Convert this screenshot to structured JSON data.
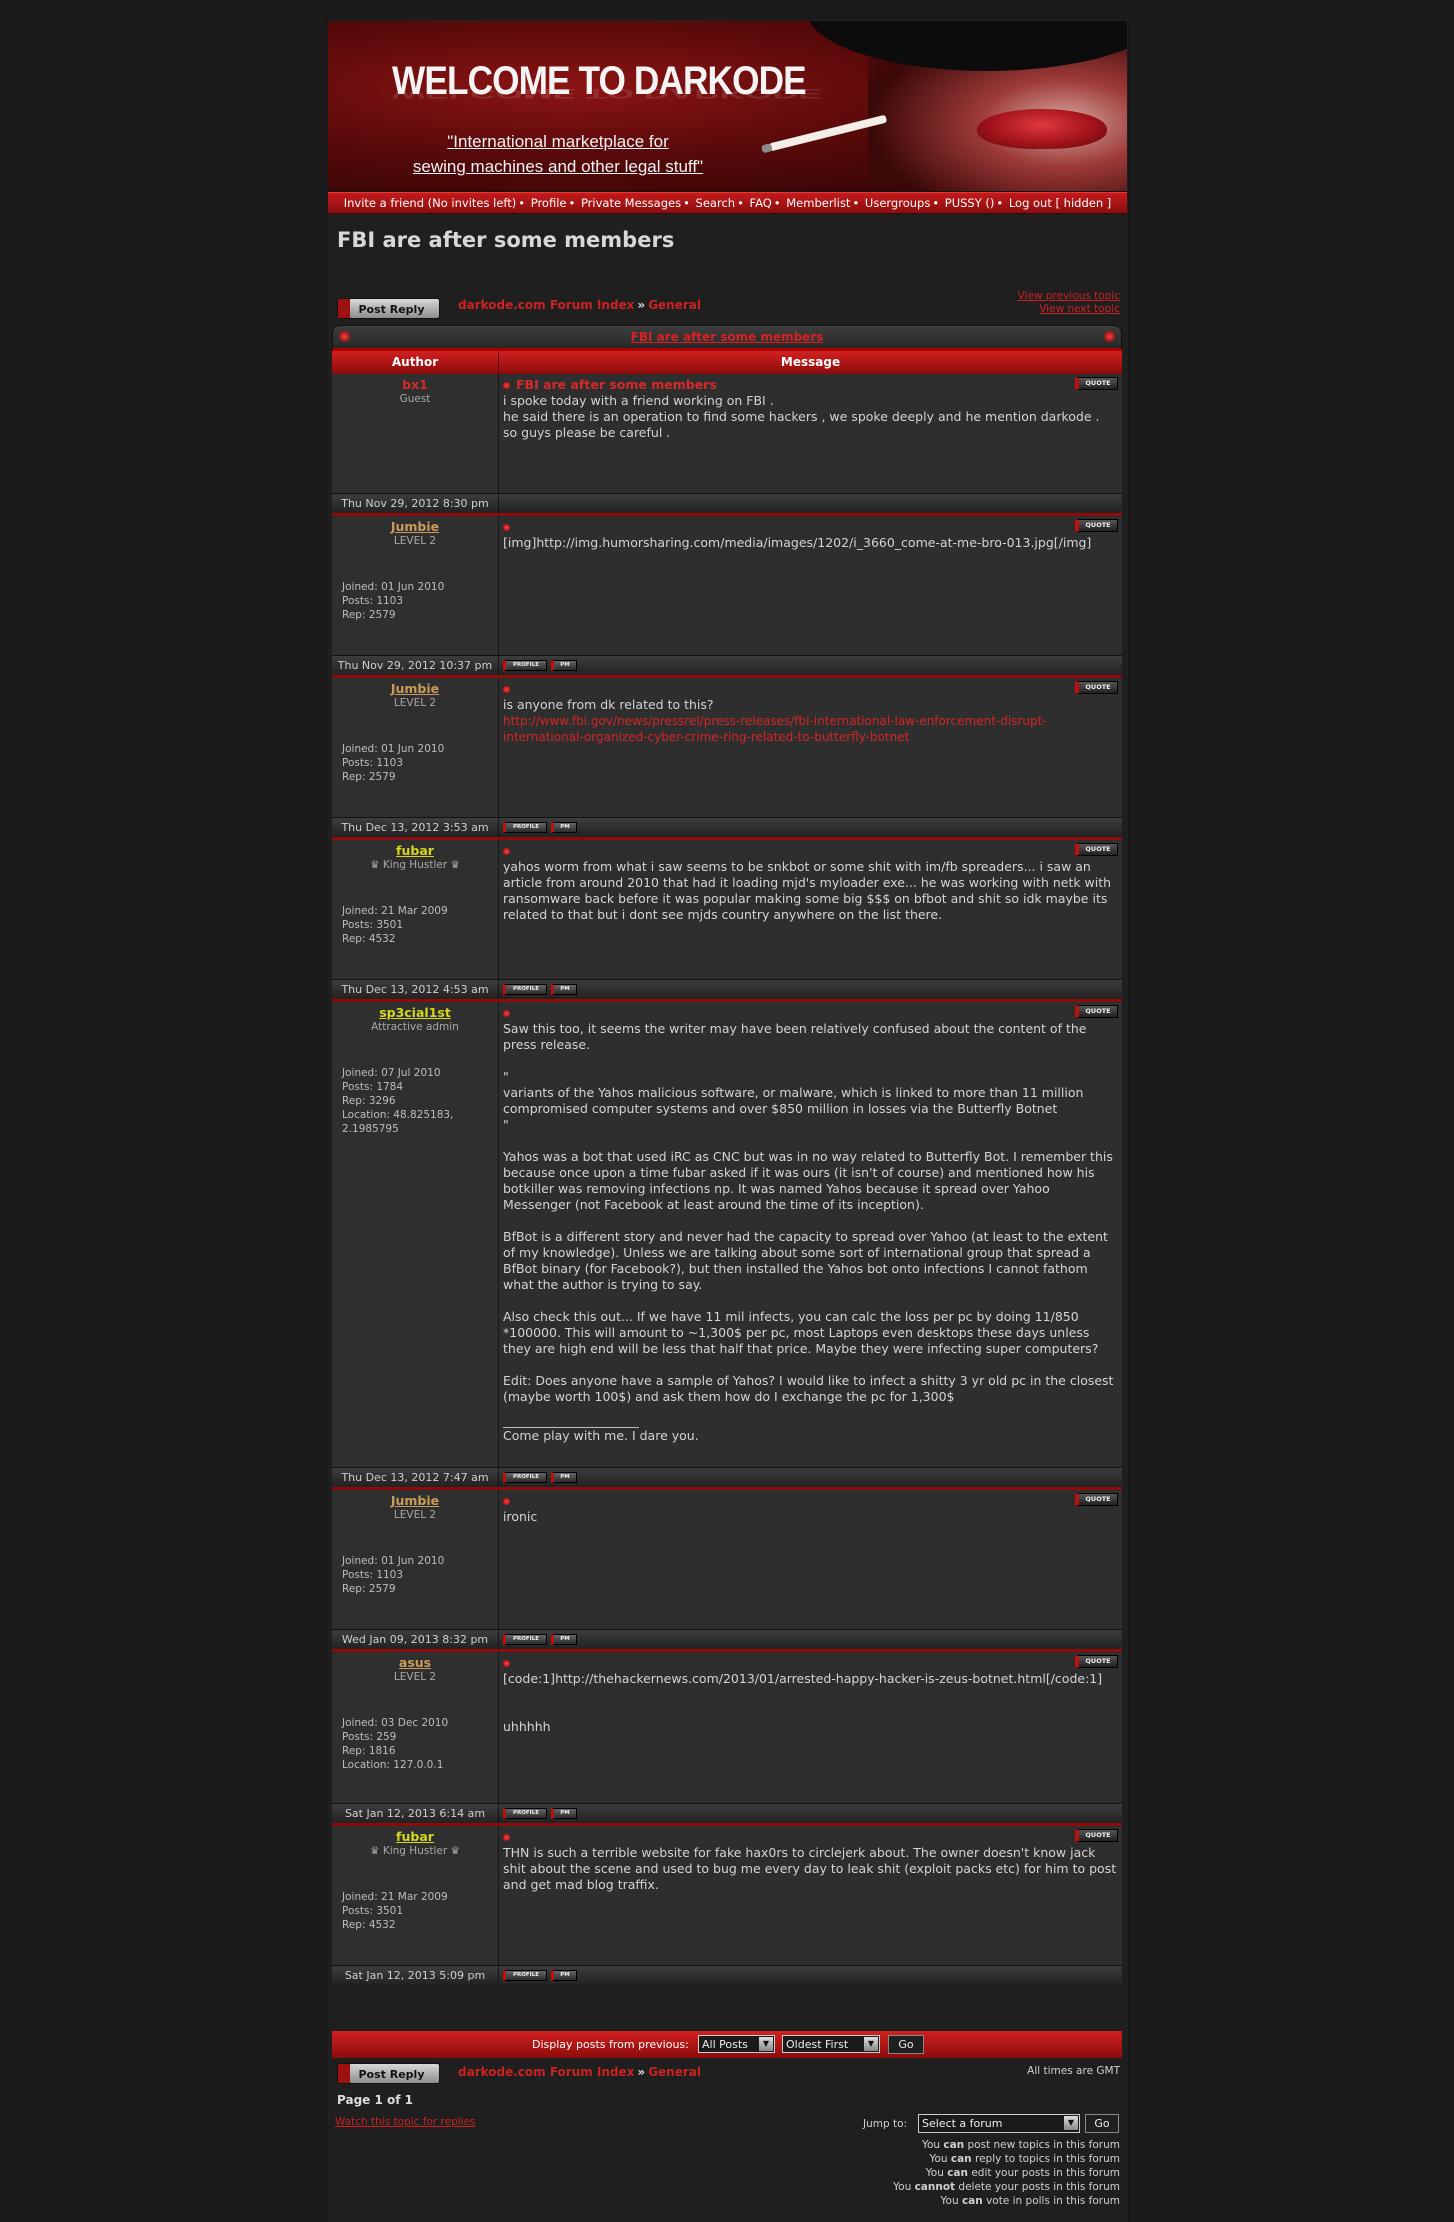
{
  "banner": {
    "title": "WELCOME TO DARKODE",
    "tagline_line1": "\"International marketplace for",
    "tagline_line2": "sewing machines and other legal stuff\""
  },
  "nav": {
    "items": [
      "Invite a friend (No invites left)",
      "Profile",
      "Private Messages",
      "Search",
      "FAQ",
      "Memberlist",
      "Usergroups",
      "PUSSY ()",
      "Log out [ hidden ]"
    ]
  },
  "page_title": "FBI are after some members",
  "post_reply_label": "Post Reply",
  "breadcrumb": {
    "index": "darkode.com Forum Index",
    "sep": "»",
    "forum": "General"
  },
  "view_previous": "View previous topic",
  "view_next": "View next topic",
  "topic_header": "FBI are after some members",
  "columns": {
    "author": "Author",
    "message": "Message"
  },
  "quote_label": "QUOTE",
  "profile_label": "PROFILE",
  "pm_label": "PM",
  "posts": [
    {
      "author": "bx1",
      "author_color": "#d62a2a",
      "rank": "Guest",
      "subject": "FBI are after some members",
      "lines": [
        "i spoke today with a friend working on FBI .",
        "he said there is an operation to find some hackers , we spoke deeply and he mention darkode .",
        "so guys please be careful ."
      ],
      "date": "Thu Nov 29, 2012 8:30 pm"
    },
    {
      "author": "Jumbie",
      "author_color": "#c99b5a",
      "rank": "LEVEL 2",
      "joined": "Joined: 01 Jun 2010",
      "posts": "Posts: 1103",
      "rep": "Rep: 2579",
      "lines": [
        "[img]http://img.humorsharing.com/media/images/1202/i_3660_come-at-me-bro-013.jpg[/img]"
      ],
      "date": "Thu Nov 29, 2012 10:37 pm"
    },
    {
      "author": "Jumbie",
      "author_color": "#c99b5a",
      "rank": "LEVEL 2",
      "joined": "Joined: 01 Jun 2010",
      "posts": "Posts: 1103",
      "rep": "Rep: 2579",
      "lines": [
        "is anyone from dk related to this?"
      ],
      "link": "http://www.fbi.gov/news/pressrel/press-releases/fbi-international-law-enforcement-disrupt-international-organized-cyber-crime-ring-related-to-butterfly-botnet",
      "date": "Thu Dec 13, 2012 3:53 am"
    },
    {
      "author": "fubar",
      "author_color": "#d6d61c",
      "rank": "♛ King Hustler ♛",
      "joined": "Joined: 21 Mar 2009",
      "posts": "Posts: 3501",
      "rep": "Rep: 4532",
      "lines": [
        "yahos worm from what i saw seems to be snkbot or some shit with im/fb spreaders... i saw an article from around 2010 that had it loading mjd's myloader exe... he was working with netk with ransomware back before it was popular making some big $$$ on bfbot and shit so idk maybe its related to that but i dont see mjds country anywhere on the list there."
      ],
      "date": "Thu Dec 13, 2012 4:53 am"
    },
    {
      "author": "sp3cial1st",
      "author_color": "#d6d61c",
      "rank": "Attractive admin",
      "joined": "Joined: 07 Jul 2010",
      "posts": "Posts: 1784",
      "rep": "Rep: 3296",
      "location": "Location: 48.825183, 2.1985795",
      "paragraphs": [
        "Saw this too, it seems the writer may have been relatively confused about the content of the press release.",
        "\"\nvariants of the Yahos malicious software, or malware, which is linked to more than 11 million compromised computer systems and over $850 million in losses via the Butterfly Botnet\n\"",
        "Yahos was a bot that used iRC as CNC but was in no way related to Butterfly Bot. I remember this because once upon a time fubar asked if it was ours (it isn't of course) and mentioned how his botkiller was removing infections np. It was named Yahos because it spread over Yahoo Messenger (not Facebook at least around the time of its inception).",
        "BfBot is a different story and never had the capacity to spread over Yahoo (at least to the extent of my knowledge). Unless we are talking about some sort of international group that spread a BfBot binary (for Facebook?), but then installed the Yahos bot onto infections I cannot fathom what the author is trying to say.",
        "Also check this out... If we have 11 mil infects, you can calc the loss per pc by doing 11/850 *100000. This will amount to ~1,300$ per pc, most Laptops even desktops these days unless they are high end will be less that half that price. Maybe they were infecting super computers?",
        "Edit: Does anyone have a sample of Yahos? I would like to infect a shitty 3 yr old pc in the closest (maybe worth 100$) and ask them how do I exchange the pc for 1,300$"
      ],
      "signature": "Come play with me. I dare you.",
      "date": "Thu Dec 13, 2012 7:47 am"
    },
    {
      "author": "Jumbie",
      "author_color": "#c99b5a",
      "rank": "LEVEL 2",
      "joined": "Joined: 01 Jun 2010",
      "posts": "Posts: 1103",
      "rep": "Rep: 2579",
      "lines": [
        "ironic"
      ],
      "date": "Wed Jan 09, 2013 8:32 pm"
    },
    {
      "author": "asus",
      "author_color": "#c99b5a",
      "rank": "LEVEL 2",
      "joined": "Joined: 03 Dec 2010",
      "posts": "Posts: 259",
      "rep": "Rep: 1816",
      "location": "Location: 127.0.0.1",
      "lines": [
        "[code:1]http://thehackernews.com/2013/01/arrested-happy-hacker-is-zeus-botnet.html[/code:1]"
      ],
      "extra": "uhhhhh",
      "date": "Sat Jan 12, 2013 6:14 am"
    },
    {
      "author": "fubar",
      "author_color": "#d6d61c",
      "rank": "♛ King Hustler ♛",
      "joined": "Joined: 21 Mar 2009",
      "posts": "Posts: 3501",
      "rep": "Rep: 4532",
      "lines": [
        "THN is such a terrible website for fake hax0rs to circlejerk about. The owner doesn't know jack shit about the scene and used to bug me every day to leak shit (exploit packs etc) for him to post and get mad blog traffix."
      ],
      "date": "Sat Jan 12, 2013 5:09 pm"
    }
  ],
  "display_bar": {
    "label": "Display posts from previous:",
    "period": "All Posts",
    "order": "Oldest First",
    "go": "Go"
  },
  "timezone": "All times are GMT",
  "page_info": "Page 1 of 1",
  "watch_link": "Watch this topic for replies",
  "jump": {
    "label": "Jump to:",
    "placeholder": "Select a forum",
    "go": "Go"
  },
  "permissions": [
    {
      "pre": "You ",
      "b": "can",
      "post": " post new topics in this forum"
    },
    {
      "pre": "You ",
      "b": "can",
      "post": " reply to topics in this forum"
    },
    {
      "pre": "You ",
      "b": "can",
      "post": " edit your posts in this forum"
    },
    {
      "pre": "You ",
      "b": "cannot",
      "post": " delete your posts in this forum"
    },
    {
      "pre": "You ",
      "b": "can",
      "post": " vote in polls in this forum"
    }
  ]
}
